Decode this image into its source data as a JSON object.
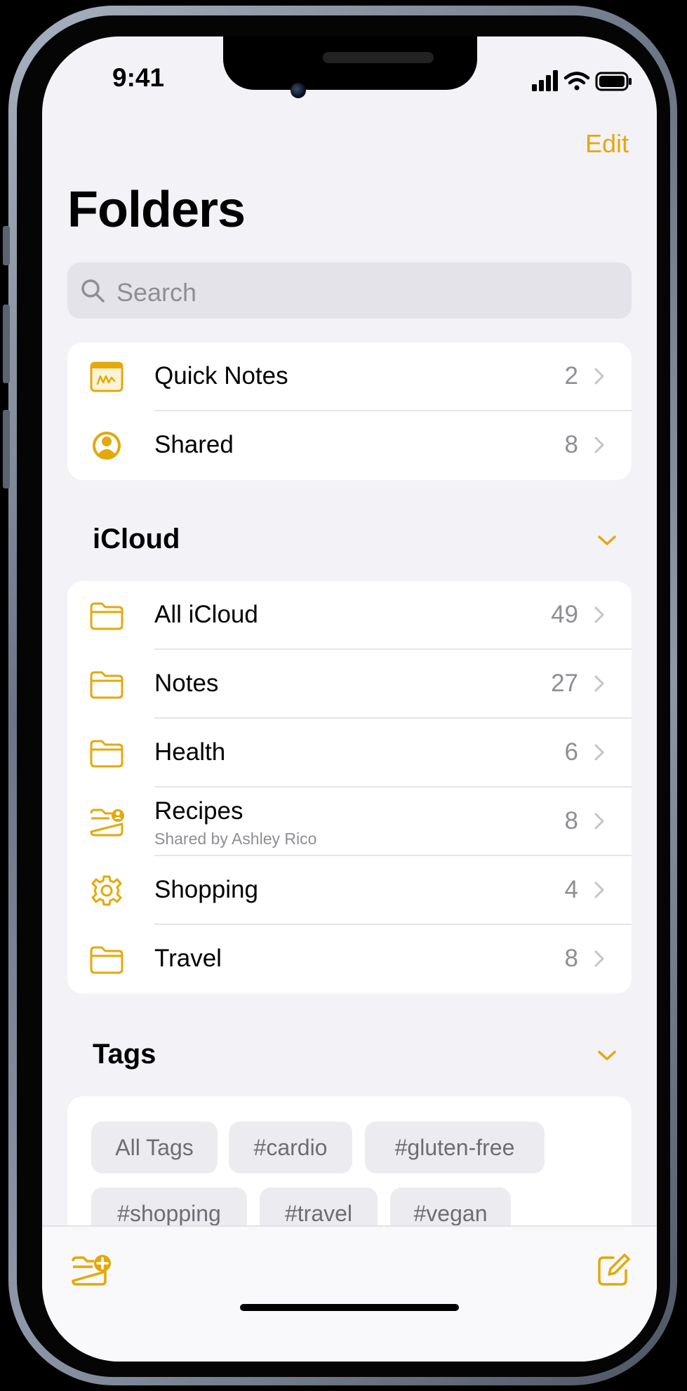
{
  "status_bar": {
    "time": "9:41"
  },
  "nav": {
    "edit_label": "Edit",
    "title": "Folders"
  },
  "search": {
    "placeholder": "Search"
  },
  "top_folders": [
    {
      "label": "Quick Notes",
      "count": "2",
      "icon": "quick-notes-icon"
    },
    {
      "label": "Shared",
      "count": "8",
      "icon": "shared-person-icon"
    }
  ],
  "icloud": {
    "header": "iCloud",
    "folders": [
      {
        "label": "All iCloud",
        "count": "49",
        "icon": "folder-icon"
      },
      {
        "label": "Notes",
        "count": "27",
        "icon": "folder-icon"
      },
      {
        "label": "Health",
        "count": "6",
        "icon": "folder-icon"
      },
      {
        "label": "Recipes",
        "sublabel": "Shared by Ashley Rico",
        "count": "8",
        "icon": "shared-folder-icon"
      },
      {
        "label": "Shopping",
        "count": "4",
        "icon": "gear-icon"
      },
      {
        "label": "Travel",
        "count": "8",
        "icon": "folder-icon"
      }
    ]
  },
  "tags": {
    "header": "Tags",
    "items": [
      "All Tags",
      "#cardio",
      "#gluten-free",
      "#shopping",
      "#travel",
      "#vegan"
    ]
  },
  "toolbar": {
    "left_icon": "new-folder-icon",
    "right_icon": "compose-icon"
  },
  "colors": {
    "accent": "#e3a90b",
    "background": "#f2f2f7",
    "secondary_text": "#8e8e93"
  }
}
